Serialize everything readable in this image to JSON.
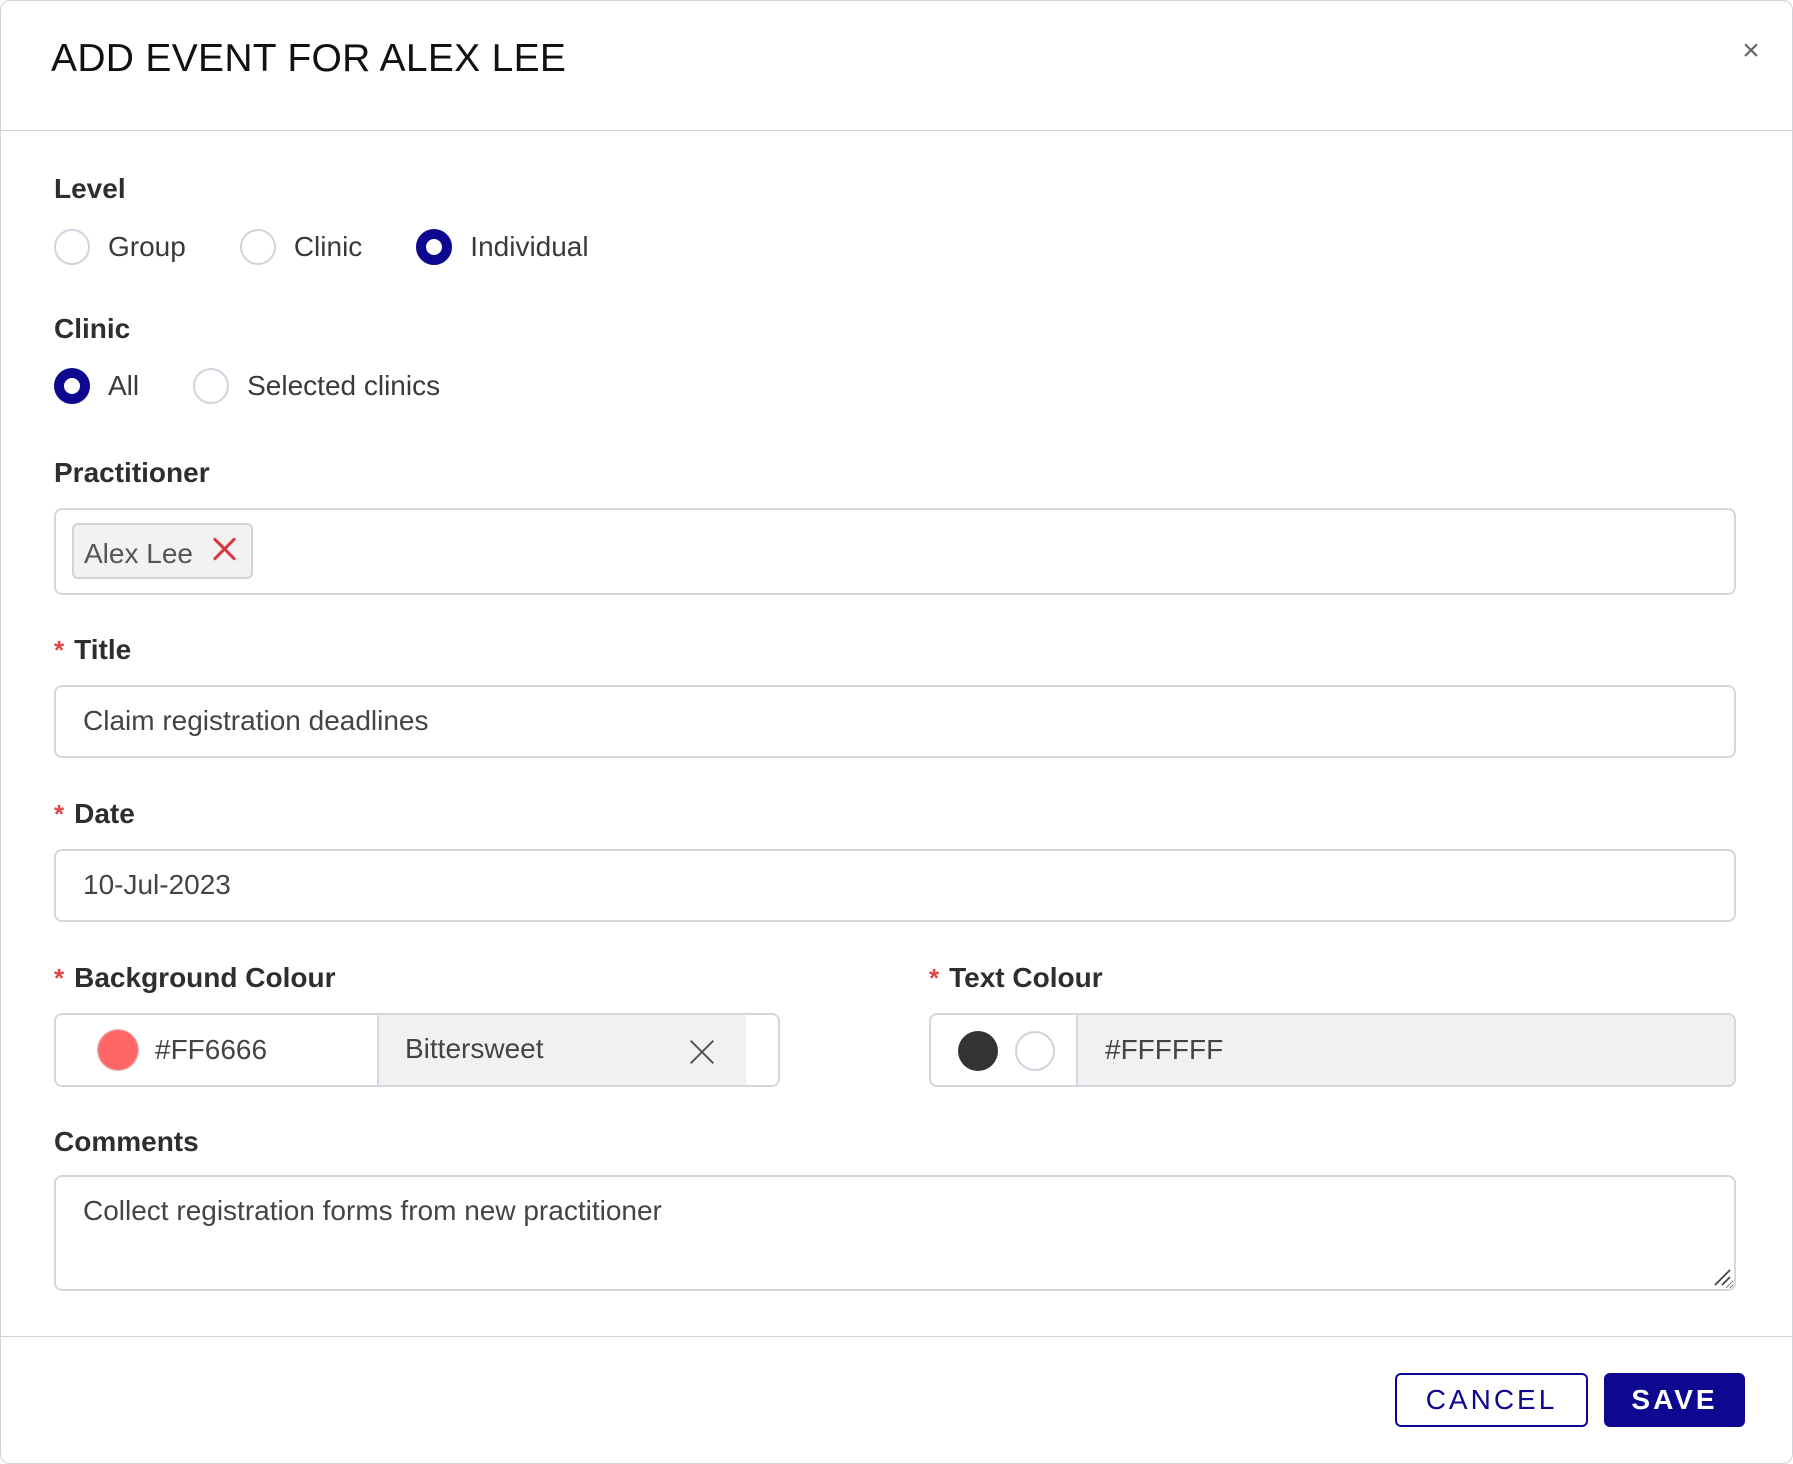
{
  "dialog": {
    "title": "ADD EVENT FOR ALEX LEE",
    "close_symbol": "×"
  },
  "level": {
    "label": "Level",
    "options": [
      {
        "label": "Group",
        "checked": false
      },
      {
        "label": "Clinic",
        "checked": false
      },
      {
        "label": "Individual",
        "checked": true
      }
    ]
  },
  "clinic": {
    "label": "Clinic",
    "options": [
      {
        "label": "All",
        "checked": true
      },
      {
        "label": "Selected clinics",
        "checked": false
      }
    ]
  },
  "practitioner": {
    "label": "Practitioner",
    "tags": [
      "Alex Lee"
    ]
  },
  "title_field": {
    "required_mark": "*",
    "label": "Title",
    "value": "Claim registration deadlines"
  },
  "date_field": {
    "required_mark": "*",
    "label": "Date",
    "value": "10-Jul-2023"
  },
  "background_colour": {
    "required_mark": "*",
    "label": "Background Colour",
    "hex": "#FF6666",
    "name": "Bittersweet",
    "swatch_color": "#FF6666"
  },
  "text_colour": {
    "required_mark": "*",
    "label": "Text Colour",
    "hex": "#FFFFFF",
    "options": [
      {
        "color": "#333333",
        "selected": true
      },
      {
        "color": "#FFFFFF",
        "selected": false
      }
    ]
  },
  "comments": {
    "label": "Comments",
    "value": "Collect registration forms from new practitioner"
  },
  "footer": {
    "cancel_label": "CANCEL",
    "save_label": "SAVE"
  },
  "theme": {
    "primary": "#0E0890",
    "required": "#E04545",
    "border": "#D3D7DE"
  }
}
